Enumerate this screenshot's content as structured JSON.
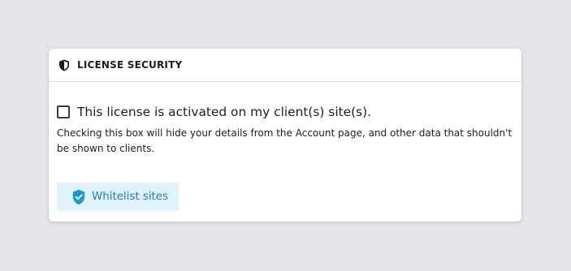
{
  "panel": {
    "icon": "shield-half-icon",
    "title": "LICENSE SECURITY"
  },
  "option": {
    "checked": false,
    "label": "This license is activated on my client(s) site(s).",
    "description": "Checking this box will hide your details from the Account page, and other data that shouldn't be shown to clients."
  },
  "whitelist_button": {
    "icon": "shield-check-icon",
    "label": "Whitelist sites",
    "accent_color": "#1c9ad6",
    "background_color": "#e0f2fb"
  }
}
